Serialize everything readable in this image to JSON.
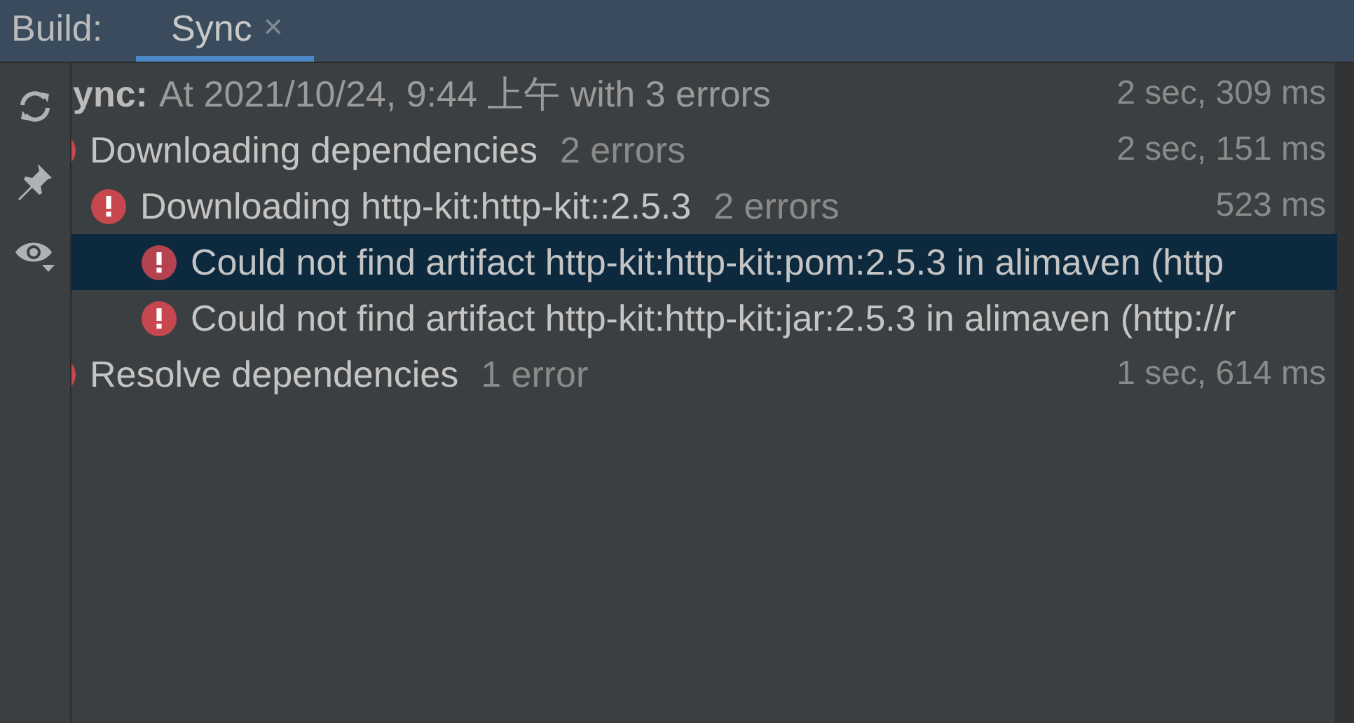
{
  "header": {
    "label": "Build:",
    "tabs": [
      {
        "label": "Sync",
        "selected": true,
        "close": "×"
      }
    ]
  },
  "tree": {
    "root": {
      "title": "ync:",
      "text": "At 2021/10/24, 9:44 上午 with 3 errors",
      "time": "2 sec, 309 ms",
      "selected": false,
      "children": [
        {
          "title": "Downloading dependencies",
          "count": "2 errors",
          "time": "2 sec, 151 ms",
          "error": true,
          "selected": false,
          "children": [
            {
              "title": "Downloading http-kit:http-kit::2.5.3",
              "count": "2 errors",
              "time": "523 ms",
              "error": true,
              "selected": false,
              "children": [
                {
                  "title": "Could not find artifact http-kit:http-kit:pom:2.5.3 in alimaven (http",
                  "error": true,
                  "selected": true
                },
                {
                  "title": "Could not find artifact http-kit:http-kit:jar:2.5.3 in alimaven (http://r",
                  "error": true,
                  "selected": false
                }
              ]
            }
          ]
        },
        {
          "title": "Resolve dependencies",
          "count": "1 error",
          "time": "1 sec, 614 ms",
          "error": true,
          "selected": false
        }
      ]
    }
  }
}
